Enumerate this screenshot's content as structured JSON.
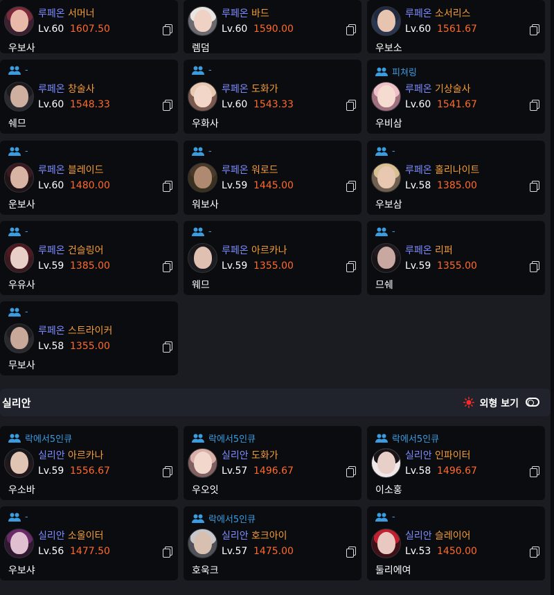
{
  "section1": {
    "cards": [
      {
        "guild": "",
        "server": "루페온",
        "class": "서머너",
        "level": "Lv.60",
        "item_level": "1607.50",
        "name": "우보사",
        "avatar_hair": "#7a2a3a",
        "avatar_face": "#e8b9a8",
        "avatar_bg": "#3a2030"
      },
      {
        "guild": "",
        "server": "루페온",
        "class": "바드",
        "level": "Lv.60",
        "item_level": "1590.00",
        "name": "렘덤",
        "avatar_hair": "#e8e6e2",
        "avatar_face": "#f0d2c4",
        "avatar_bg": "#6a6a70"
      },
      {
        "guild": "",
        "server": "루페온",
        "class": "소서리스",
        "level": "Lv.60",
        "item_level": "1561.67",
        "name": "우보소",
        "avatar_hair": "#202a40",
        "avatar_face": "#e6c4b0",
        "avatar_bg": "#2a3550"
      },
      {
        "guild": "-",
        "server": "루페온",
        "class": "창술사",
        "level": "Lv.60",
        "item_level": "1548.33",
        "name": "쉐므",
        "avatar_hair": "#1a1a1e",
        "avatar_face": "#cfb0a0",
        "avatar_bg": "#2a2a30"
      },
      {
        "guild": "-",
        "server": "루페온",
        "class": "도화가",
        "level": "Lv.60",
        "item_level": "1543.33",
        "name": "우화사",
        "avatar_hair": "#e8c8b0",
        "avatar_face": "#f2d6c8",
        "avatar_bg": "#7a5a50"
      },
      {
        "guild": "피쳐링",
        "server": "루페온",
        "class": "기상술사",
        "level": "Lv.60",
        "item_level": "1541.67",
        "name": "우비삼",
        "avatar_hair": "#f0c0c8",
        "avatar_face": "#f6dcd0",
        "avatar_bg": "#a07080"
      },
      {
        "guild": "-",
        "server": "루페온",
        "class": "블레이드",
        "level": "Lv.60",
        "item_level": "1480.00",
        "name": "운보사",
        "avatar_hair": "#3a1a20",
        "avatar_face": "#d8b4a4",
        "avatar_bg": "#201418"
      },
      {
        "guild": "-",
        "server": "루페온",
        "class": "워로드",
        "level": "Lv.59",
        "item_level": "1445.00",
        "name": "워보사",
        "avatar_hair": "#4a3a2a",
        "avatar_face": "#b08a70",
        "avatar_bg": "#3a3020"
      },
      {
        "guild": "-",
        "server": "루페온",
        "class": "홀리나이트",
        "level": "Lv.58",
        "item_level": "1385.00",
        "name": "우보삼",
        "avatar_hair": "#d8c090",
        "avatar_face": "#e8c8b0",
        "avatar_bg": "#706050"
      },
      {
        "guild": "-",
        "server": "루페온",
        "class": "건슬링어",
        "level": "Lv.59",
        "item_level": "1385.00",
        "name": "우유사",
        "avatar_hair": "#501820",
        "avatar_face": "#e8d0c8",
        "avatar_bg": "#3a1a20"
      },
      {
        "guild": "-",
        "server": "루페온",
        "class": "아르카나",
        "level": "Lv.59",
        "item_level": "1355.00",
        "name": "웨므",
        "avatar_hair": "#18181c",
        "avatar_face": "#e0c0b0",
        "avatar_bg": "#1c1c22"
      },
      {
        "guild": "-",
        "server": "루페온",
        "class": "리퍼",
        "level": "Lv.59",
        "item_level": "1355.00",
        "name": "므쉐",
        "avatar_hair": "#201a20",
        "avatar_face": "#c8a8a0",
        "avatar_bg": "#181418"
      },
      {
        "guild": "-",
        "server": "루페온",
        "class": "스트라이커",
        "level": "Lv.58",
        "item_level": "1355.00",
        "name": "무보사",
        "avatar_hair": "#1e1e22",
        "avatar_face": "#c8a898",
        "avatar_bg": "#2a2a2e"
      }
    ]
  },
  "section2": {
    "title": "실리안",
    "view_label": "외형 보기",
    "cards": [
      {
        "guild": "락에서5인큐",
        "server": "실리안",
        "class": "아르카나",
        "level": "Lv.59",
        "item_level": "1556.67",
        "name": "우소바",
        "avatar_hair": "#18181c",
        "avatar_face": "#e0c4b4",
        "avatar_bg": "#20181c"
      },
      {
        "guild": "락에서5인큐",
        "server": "실리안",
        "class": "도화가",
        "level": "Lv.57",
        "item_level": "1496.67",
        "name": "우오잇",
        "avatar_hair": "#d8b0a8",
        "avatar_face": "#f2d8cc",
        "avatar_bg": "#806060"
      },
      {
        "guild": "락에서5인큐",
        "server": "실리안",
        "class": "인파이터",
        "level": "Lv.58",
        "item_level": "1496.67",
        "name": "이소홍",
        "avatar_hair": "#181418",
        "avatar_face": "#e8d0c8",
        "avatar_bg": "#f0e8e8"
      },
      {
        "guild": "-",
        "server": "실리안",
        "class": "소울이터",
        "level": "Lv.56",
        "item_level": "1477.50",
        "name": "우보샤",
        "avatar_hair": "#6a2a6a",
        "avatar_face": "#e0c0d0",
        "avatar_bg": "#301830"
      },
      {
        "guild": "락에서5인큐",
        "server": "실리안",
        "class": "호크아이",
        "level": "Lv.57",
        "item_level": "1475.00",
        "name": "호욱크",
        "avatar_hair": "#c8c8cc",
        "avatar_face": "#d8c0b0",
        "avatar_bg": "#505058"
      },
      {
        "guild": "-",
        "server": "실리안",
        "class": "슬레이어",
        "level": "Lv.53",
        "item_level": "1450.00",
        "name": "둘리에여",
        "avatar_hair": "#c02030",
        "avatar_face": "#e8c8c0",
        "avatar_bg": "#401018"
      }
    ]
  },
  "colors": {
    "server": "#7c8cff",
    "class": "#f39c36",
    "item_level": "#ff6a2b",
    "guild": "#3b9ce0",
    "card_bg": "#0b0c0f",
    "page_bg": "#1a1c22",
    "accent_sun": "#ff2a2a"
  },
  "icons": {
    "guild": "people-icon",
    "copy": "copy-icon",
    "view": "sun-icon",
    "toggle": "toggle-icon"
  }
}
